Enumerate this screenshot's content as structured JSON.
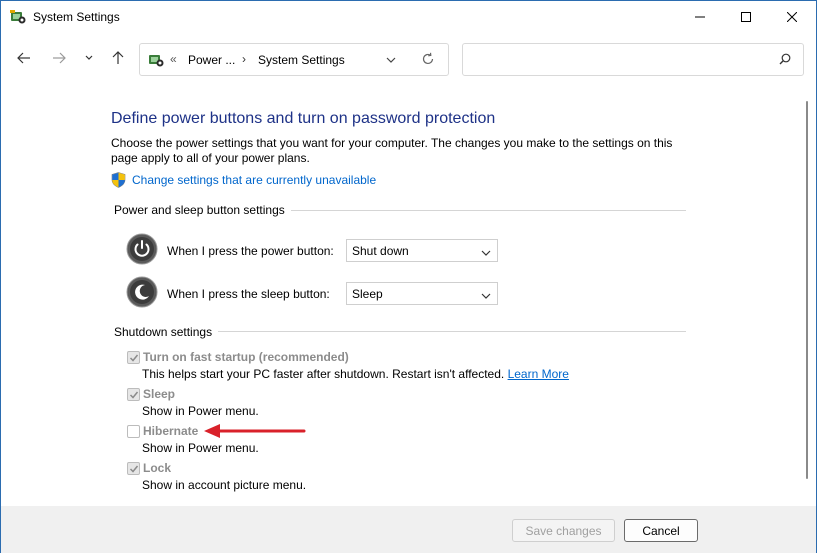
{
  "window": {
    "title": "System Settings"
  },
  "address_bar": {
    "overflow": "«",
    "crumb1": "Power ...",
    "separator": "›",
    "crumb2": "System Settings",
    "search_placeholder": ""
  },
  "page": {
    "heading": "Define power buttons and turn on password protection",
    "description": "Choose the power settings that you want for your computer. The changes you make to the settings on this page apply to all of your power plans.",
    "change_link": "Change settings that are currently unavailable"
  },
  "power_section": {
    "title": "Power and sleep button settings",
    "power_button_label": "When I press the power button:",
    "power_button_value": "Shut down",
    "sleep_button_label": "When I press the sleep button:",
    "sleep_button_value": "Sleep"
  },
  "shutdown_section": {
    "title": "Shutdown settings",
    "items": [
      {
        "label": "Turn on fast startup (recommended)",
        "checked": true,
        "desc": "This helps start your PC faster after shutdown. Restart isn't affected.",
        "link": "Learn More"
      },
      {
        "label": "Sleep",
        "checked": true,
        "desc": "Show in Power menu."
      },
      {
        "label": "Hibernate",
        "checked": false,
        "desc": "Show in Power menu."
      },
      {
        "label": "Lock",
        "checked": true,
        "desc": "Show in account picture menu."
      }
    ]
  },
  "footer": {
    "save_label": "Save changes",
    "cancel_label": "Cancel"
  },
  "icons": {
    "app": "control-panel-icon",
    "annotation": "red-arrow-annotation"
  },
  "colors": {
    "heading": "#1e3287",
    "link": "#0066cc",
    "annotation_arrow": "#d9212a"
  }
}
